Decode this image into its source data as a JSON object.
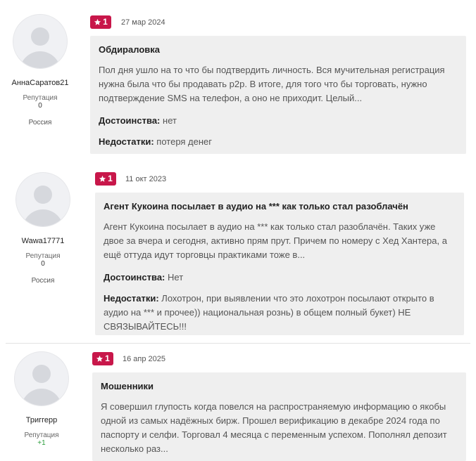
{
  "reviews": [
    {
      "user": {
        "name": "АннаСаратов21",
        "rep_label": "Репутация",
        "rep_value": "0",
        "country": "Россия"
      },
      "rating": "1",
      "date": "27 мар 2024",
      "title": "Обдираловка",
      "text": "Пол дня ушло на то что бы подтвердить личность. Вся мучительная регистрация нужна была что бы продавать p2p. В итоге, для того что бы торговать, нужно подтверждение SMS на телефон, а оно не приходит. Целый...",
      "pros_label": "Достоинства:",
      "pros": "нет",
      "cons_label": "Недостатки:",
      "cons": "потеря денег"
    },
    {
      "user": {
        "name": "Wawa17771",
        "rep_label": "Репутация",
        "rep_value": "0",
        "country": "Россия"
      },
      "rating": "1",
      "date": "11 окт 2023",
      "title": "Агент Кукоина посылает в аудио на *** как только стал разоблачён",
      "text": "Агент Кукоина посылает в аудио на *** как только стал разоблачён. Таких уже двое за вчера и сегодня, активно прям прут. Причем по номеру с Хед Хантера, а ещё оттуда идут торговцы практиками тоже в...",
      "pros_label": "Достоинства:",
      "pros": "Нет",
      "cons_label": "Недостатки:",
      "cons": "Лохотрон, при выявлении что это лохотрон посылают открыто в аудио на *** и прочее)) национальная рознь) в общем полный букет) НЕ СВЯЗЫВАЙТЕСЬ!!!"
    },
    {
      "user": {
        "name": "Триггерр",
        "rep_label": "Репутация",
        "rep_value": "+1",
        "country": ""
      },
      "rating": "1",
      "date": "16 апр 2025",
      "title": "Мошенники",
      "text": "Я совершил глупость когда повелся на распространяемую информацию о якобы одной из самых надёжных бирж. Прошел верификацию в декабре 2024 года по паспорту и селфи. Торговал 4 месяца с переменным успехом. Пополнял депозит несколько раз..."
    }
  ],
  "colors": {
    "badge": "#c8174a",
    "card": "#efefef",
    "positive": "#2a9d3b"
  },
  "icons": {
    "rating": "star-icon",
    "avatar": "default-avatar-icon"
  }
}
